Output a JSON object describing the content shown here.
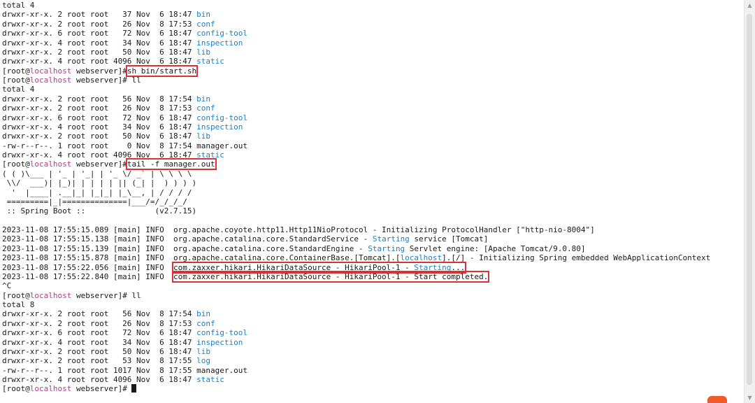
{
  "prompt": {
    "user": "[root@",
    "host": "localhost",
    "dir": " webserver]#"
  },
  "commands": {
    "start": "sh bin/start.sh",
    "ll": " ll",
    "tail": "tail -f manager.out",
    "interrupt": "^C"
  },
  "listing1": {
    "total": "total 4",
    "rows": [
      {
        "meta": "drwxr-xr-x. 2 root root   37 Nov  6 18:47 ",
        "name": "bin",
        "type": "dir"
      },
      {
        "meta": "drwxr-xr-x. 2 root root   26 Nov  8 17:53 ",
        "name": "conf",
        "type": "dir"
      },
      {
        "meta": "drwxr-xr-x. 6 root root   72 Nov  6 18:47 ",
        "name": "config-tool",
        "type": "dir"
      },
      {
        "meta": "drwxr-xr-x. 4 root root   34 Nov  6 18:47 ",
        "name": "inspection",
        "type": "dir"
      },
      {
        "meta": "drwxr-xr-x. 2 root root   50 Nov  6 18:47 ",
        "name": "lib",
        "type": "dir"
      },
      {
        "meta": "drwxr-xr-x. 4 root root 4096 Nov  6 18:47 ",
        "name": "static",
        "type": "dir"
      }
    ]
  },
  "listing2": {
    "total": "total 4",
    "rows": [
      {
        "meta": "drwxr-xr-x. 2 root root   56 Nov  8 17:54 ",
        "name": "bin",
        "type": "dir"
      },
      {
        "meta": "drwxr-xr-x. 2 root root   26 Nov  8 17:53 ",
        "name": "conf",
        "type": "dir"
      },
      {
        "meta": "drwxr-xr-x. 6 root root   72 Nov  6 18:47 ",
        "name": "config-tool",
        "type": "dir"
      },
      {
        "meta": "drwxr-xr-x. 4 root root   34 Nov  6 18:47 ",
        "name": "inspection",
        "type": "dir"
      },
      {
        "meta": "drwxr-xr-x. 2 root root   50 Nov  6 18:47 ",
        "name": "lib",
        "type": "dir"
      },
      {
        "meta": "-rw-r--r--. 1 root root    0 Nov  8 17:54 ",
        "name": "manager.out",
        "type": "file"
      },
      {
        "meta": "drwxr-xr-x. 4 root root 4096 Nov  6 18:47 ",
        "name": "static",
        "type": "dir"
      }
    ]
  },
  "banner": {
    "lines": [
      "( ( )\\___ | '_ | '_| | '_ \\/ _` | \\ \\ \\ \\",
      " \\\\/  ___)| |_)| | | | | || (_| |  ) ) ) )",
      "  '  |____| .__|_| |_|_| |_\\__, | / / / /",
      " =========|_|==============|___/=/_/_/_/"
    ],
    "spring_label": " :: Spring Boot :: ",
    "version": "              (v2.7.15)"
  },
  "logs": [
    {
      "ts": "2023-11-08 17:55:15.089 [main] INFO  ",
      "pre": "org.apache.coyote.http11.Http11NioProtocol - Initializing ProtocolHandler [\"http-nio-8004\"]",
      "kw": "",
      "post": "",
      "highlight": false
    },
    {
      "ts": "2023-11-08 17:55:15.138 [main] INFO  ",
      "pre": "org.apache.catalina.core.StandardService - ",
      "kw": "Starting",
      "post": " service [Tomcat]",
      "highlight": false
    },
    {
      "ts": "2023-11-08 17:55:15.139 [main] INFO  ",
      "pre": "org.apache.catalina.core.StandardEngine - ",
      "kw": "Starting",
      "post": " Servlet engine: [Apache Tomcat/9.0.80]",
      "highlight": false
    },
    {
      "ts": "2023-11-08 17:55:15.878 [main] INFO  ",
      "pre": "org.apache.catalina.core.ContainerBase.[Tomcat].[",
      "kw": "localhost",
      "post": "].[/] - Initializing Spring embedded WebApplicationContext",
      "highlight": false
    },
    {
      "ts": "2023-11-08 17:55:22.056 [main] INFO  ",
      "pre": "com.zaxxer.hikari.HikariDataSource - HikariPool-1 - ",
      "kw": "Starting",
      "post": "...",
      "highlight": true
    },
    {
      "ts": "2023-11-08 17:55:22.840 [main] INFO  ",
      "pre": "com.zaxxer.hikari.HikariDataSource - HikariPool-1 - Start completed.",
      "kw": "",
      "post": "",
      "highlight": true
    }
  ],
  "listing3": {
    "total": "total 8",
    "rows": [
      {
        "meta": "drwxr-xr-x. 2 root root   56 Nov  8 17:54 ",
        "name": "bin",
        "type": "dir"
      },
      {
        "meta": "drwxr-xr-x. 2 root root   26 Nov  8 17:53 ",
        "name": "conf",
        "type": "dir"
      },
      {
        "meta": "drwxr-xr-x. 6 root root   72 Nov  6 18:47 ",
        "name": "config-tool",
        "type": "dir"
      },
      {
        "meta": "drwxr-xr-x. 4 root root   34 Nov  6 18:47 ",
        "name": "inspection",
        "type": "dir"
      },
      {
        "meta": "drwxr-xr-x. 2 root root   50 Nov  6 18:47 ",
        "name": "lib",
        "type": "dir"
      },
      {
        "meta": "drwxr-xr-x. 2 root root   53 Nov  8 17:55 ",
        "name": "log",
        "type": "dir"
      },
      {
        "meta": "-rw-r--r--. 1 root root 1017 Nov  8 17:55 ",
        "name": "manager.out",
        "type": "file"
      },
      {
        "meta": "drwxr-xr-x. 4 root root 4096 Nov  6 18:47 ",
        "name": "static",
        "type": "dir"
      }
    ]
  },
  "colors": {
    "dir": "#1f7fc4",
    "host": "#b0408a",
    "highlight": "#d83232",
    "text": "#1a1a1a",
    "background": "#ffffff"
  },
  "icons": {
    "scroll_up": "triangle-up-icon",
    "scroll_down": "triangle-down-icon",
    "watermark": "logo-icon"
  }
}
